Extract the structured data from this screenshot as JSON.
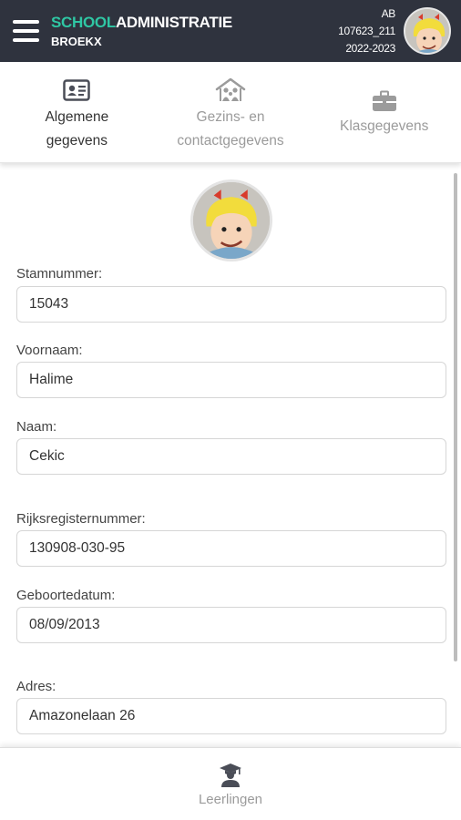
{
  "header": {
    "brand_school": "SCHOOL",
    "brand_admin": "ADMINISTRATIE",
    "brand_sub": "BROEKX",
    "user_initials": "AB",
    "user_code": "107623_211",
    "school_year": "2022-2023",
    "menu_icon": "hamburger-menu-icon",
    "avatar_icon": "cartoon-girl-avatar"
  },
  "tabs": [
    {
      "label_line1": "Algemene",
      "label_line2": "gegevens",
      "icon": "id-card-icon",
      "active": true
    },
    {
      "label_line1": "Gezins- en",
      "label_line2": "contactgegevens",
      "icon": "family-home-icon",
      "active": false
    },
    {
      "label": "Klasgegevens",
      "icon": "briefcase-icon",
      "active": false
    }
  ],
  "form": {
    "stamnummer_label": "Stamnummer:",
    "stamnummer_value": "15043",
    "voornaam_label": "Voornaam:",
    "voornaam_value": "Halime",
    "naam_label": "Naam:",
    "naam_value": "Cekic",
    "rrn_label": "Rijksregisternummer:",
    "rrn_value": "130908-030-95",
    "geboortedatum_label": "Geboortedatum:",
    "geboortedatum_value": "08/09/2013",
    "adres_label": "Adres:",
    "adres_value": "Amazonelaan 26"
  },
  "bottom_nav": {
    "label": "Leerlingen",
    "icon": "graduate-student-icon"
  },
  "colors": {
    "header_bg": "#2f333e",
    "brand_accent": "#2fc7a4",
    "icon_active": "#4a4d57",
    "icon_inactive": "#9b9b9b"
  }
}
